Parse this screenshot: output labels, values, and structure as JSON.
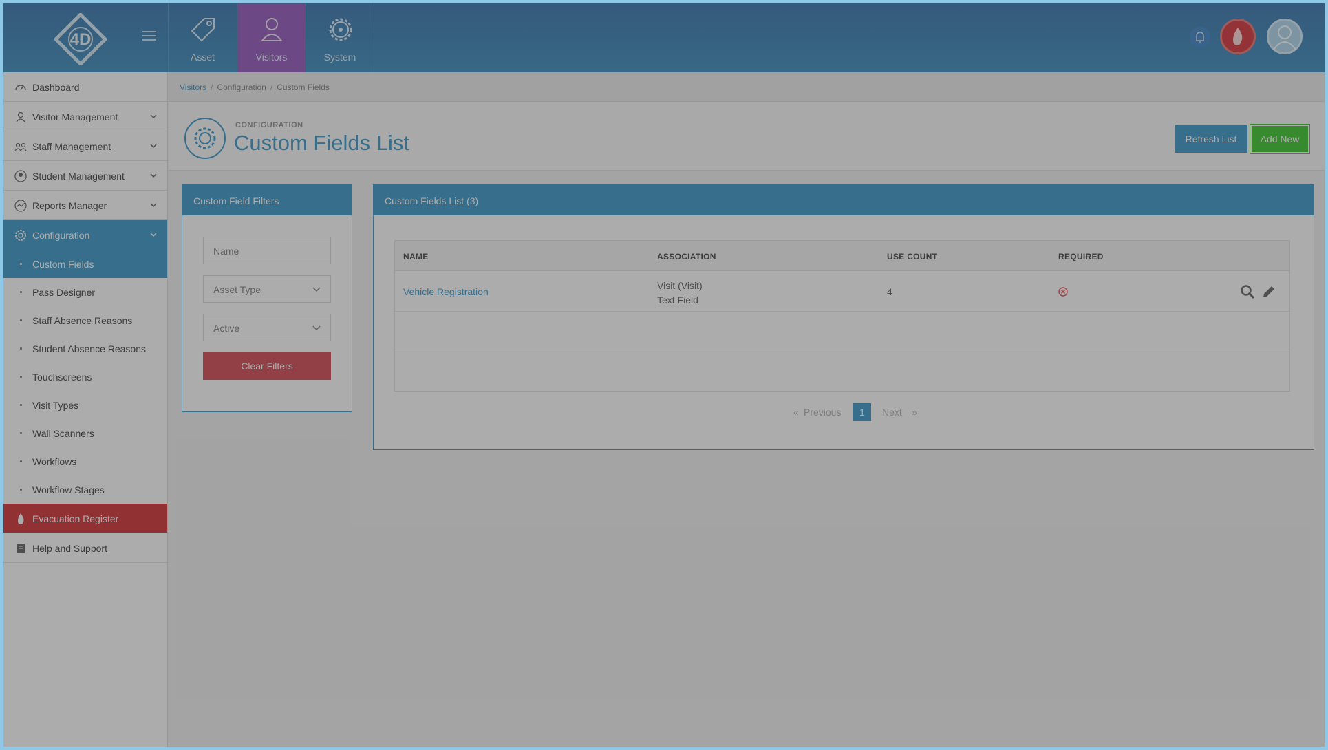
{
  "topbar": {
    "logo_text": "4D",
    "modules": [
      {
        "label": "Asset",
        "icon": "tag-icon"
      },
      {
        "label": "Visitors",
        "icon": "user-icon"
      },
      {
        "label": "System",
        "icon": "gear-icon"
      }
    ],
    "active_module": "Visitors",
    "right_icons": [
      "bell-icon",
      "flame-icon",
      "avatar"
    ]
  },
  "sidebar": {
    "items": [
      {
        "label": "Dashboard",
        "icon": "dashboard-icon"
      },
      {
        "label": "Visitor Management",
        "icon": "user-icon"
      },
      {
        "label": "Staff Management",
        "icon": "group-icon"
      },
      {
        "label": "Student Management",
        "icon": "student-icon"
      },
      {
        "label": "Reports Manager",
        "icon": "chart-icon"
      },
      {
        "label": "Configuration",
        "icon": "gear-icon"
      }
    ],
    "config_sub": [
      "Custom Fields",
      "Pass Designer",
      "Staff Absence Reasons",
      "Student Absence Reasons",
      "Touchscreens",
      "Visit Types",
      "Wall Scanners",
      "Workflows",
      "Workflow Stages"
    ],
    "evacuation": "Evacuation Register",
    "help": "Help and Support"
  },
  "breadcrumb": [
    "Visitors",
    "Configuration",
    "Custom Fields"
  ],
  "header": {
    "subtitle": "CONFIGURATION",
    "title": "Custom Fields List",
    "refresh_label": "Refresh List",
    "add_label": "Add New"
  },
  "filters": {
    "title": "Custom Field Filters",
    "name_placeholder": "Name",
    "asset_type": "Asset Type",
    "status": "Active",
    "clear_label": "Clear Filters"
  },
  "list": {
    "title": "Custom Fields List (3)",
    "columns": [
      "NAME",
      "ASSOCIATION",
      "USE COUNT",
      "REQUIRED"
    ],
    "rows": [
      {
        "name": "Vehicle Registration",
        "association_1": "Visit (Visit)",
        "association_2": "Text Field",
        "use_count": "4",
        "required": "no"
      }
    ],
    "pager": {
      "prev": "Previous",
      "page": "1",
      "next": "Next",
      "prev_glyph": "«",
      "next_glyph": "»"
    }
  },
  "colors": {
    "accent": "#2a8fc3",
    "success": "#2ac41a",
    "danger": "#cf1f25",
    "visitors_module": "#8a4ab8"
  }
}
